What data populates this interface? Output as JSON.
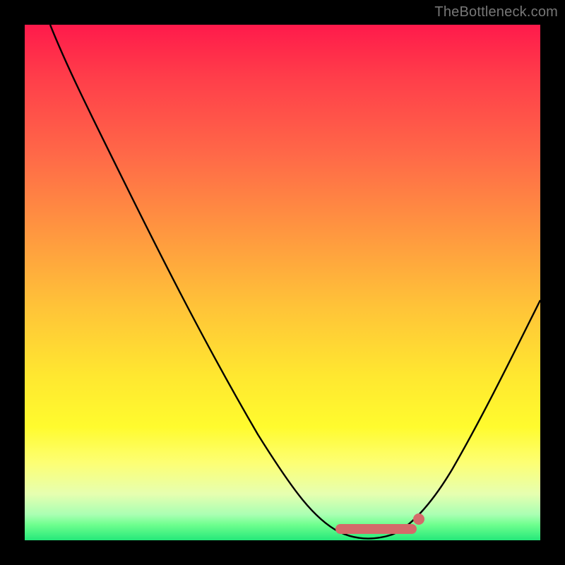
{
  "watermark": "TheBottleneck.com",
  "chart_data": {
    "type": "line",
    "title": "",
    "xlabel": "",
    "ylabel": "",
    "xlim": [
      0,
      100
    ],
    "ylim": [
      0,
      100
    ],
    "grid": false,
    "series": [
      {
        "name": "bottleneck-curve",
        "x": [
          5,
          10,
          20,
          30,
          40,
          50,
          57,
          62,
          66,
          70,
          74,
          78,
          85,
          92,
          100
        ],
        "y": [
          100,
          92,
          76,
          60,
          44,
          28,
          15,
          7,
          2,
          0,
          2,
          7,
          20,
          35,
          54
        ]
      }
    ],
    "markers": {
      "optimal_range": {
        "x_start": 61,
        "x_end": 76,
        "y": 4
      },
      "dot": {
        "x": 76,
        "y": 5
      }
    },
    "colors": {
      "curve": "#000000",
      "marker": "#d46a6a",
      "gradient_top": "#ff1a4b",
      "gradient_bottom": "#25e87a"
    }
  }
}
